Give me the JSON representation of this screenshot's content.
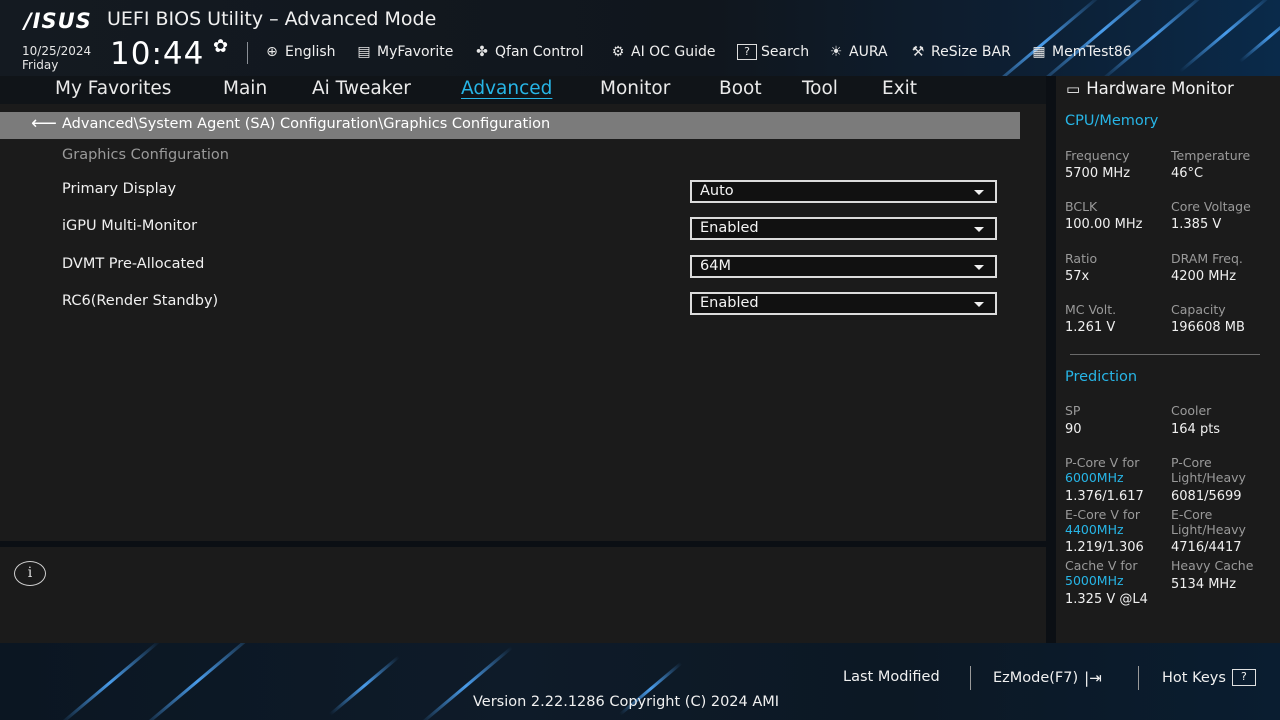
{
  "header": {
    "logo": "/ISUS",
    "title": "UEFI BIOS Utility – Advanced Mode",
    "date": "10/25/2024",
    "day": "Friday",
    "time": "10:44",
    "toolbar": [
      {
        "icon": "globe-icon",
        "glyph": "⊕",
        "label": "English"
      },
      {
        "icon": "favorite-icon",
        "glyph": "▤",
        "label": "MyFavorite"
      },
      {
        "icon": "fan-icon",
        "glyph": "❀",
        "label": "Qfan Control"
      },
      {
        "icon": "ai-oc-icon",
        "glyph": "⚙",
        "label": "AI OC Guide"
      },
      {
        "icon": "search-icon",
        "glyph": "?",
        "label": "Search"
      },
      {
        "icon": "aura-icon",
        "glyph": "☀",
        "label": "AURA"
      },
      {
        "icon": "resize-bar-icon",
        "glyph": "⚒",
        "label": "ReSize BAR"
      },
      {
        "icon": "memtest-icon",
        "glyph": "▦",
        "label": "MemTest86"
      }
    ]
  },
  "tabs": [
    {
      "label": "My Favorites"
    },
    {
      "label": "Main"
    },
    {
      "label": "Ai Tweaker"
    },
    {
      "label": "Advanced",
      "active": true
    },
    {
      "label": "Monitor"
    },
    {
      "label": "Boot"
    },
    {
      "label": "Tool"
    },
    {
      "label": "Exit"
    }
  ],
  "main": {
    "breadcrumb": "Advanced\\System Agent (SA) Configuration\\Graphics Configuration",
    "section_title": "Graphics Configuration",
    "settings": [
      {
        "label": "Primary Display",
        "value": "Auto"
      },
      {
        "label": "iGPU Multi-Monitor",
        "value": "Enabled"
      },
      {
        "label": "DVMT Pre-Allocated",
        "value": "64M"
      },
      {
        "label": "RC6(Render Standby)",
        "value": "Enabled"
      }
    ]
  },
  "hardware_monitor": {
    "title": "Hardware Monitor",
    "cpu_memory": {
      "heading": "CPU/Memory",
      "frequency_label": "Frequency",
      "frequency": "5700 MHz",
      "temperature_label": "Temperature",
      "temperature": "46°C",
      "bclk_label": "BCLK",
      "bclk": "100.00 MHz",
      "core_voltage_label": "Core Voltage",
      "core_voltage": "1.385 V",
      "ratio_label": "Ratio",
      "ratio": "57x",
      "dram_freq_label": "DRAM Freq.",
      "dram_freq": "4200 MHz",
      "mc_volt_label": "MC Volt.",
      "mc_volt": "1.261 V",
      "capacity_label": "Capacity",
      "capacity": "196608 MB"
    },
    "prediction": {
      "heading": "Prediction",
      "sp_label": "SP",
      "sp": "90",
      "cooler_label": "Cooler",
      "cooler": "164 pts",
      "pcore_v_label": "P-Core V for",
      "pcore_v_freq": "6000MHz",
      "pcore_v": "1.376/1.617",
      "pcore_lh_label_1": "P-Core",
      "pcore_lh_label_2": "Light/Heavy",
      "pcore_lh": "6081/5699",
      "ecore_v_label": "E-Core V for",
      "ecore_v_freq": "4400MHz",
      "ecore_v": "1.219/1.306",
      "ecore_lh_label_1": "E-Core",
      "ecore_lh_label_2": "Light/Heavy",
      "ecore_lh": "4716/4417",
      "cache_v_label": "Cache V for",
      "cache_v_freq": "5000MHz",
      "cache_v": "1.325 V @L4",
      "heavy_cache_label": "Heavy Cache",
      "heavy_cache": "5134 MHz"
    }
  },
  "footer": {
    "last_modified": "Last Modified",
    "ezmode": "EzMode(F7)",
    "hot_keys": "Hot Keys",
    "version": "Version 2.22.1286 Copyright (C) 2024 AMI"
  },
  "colors": {
    "accent": "#27b5e6",
    "panel": "#1b1b1b",
    "breadcrumb_bg": "#7b7b7b"
  }
}
